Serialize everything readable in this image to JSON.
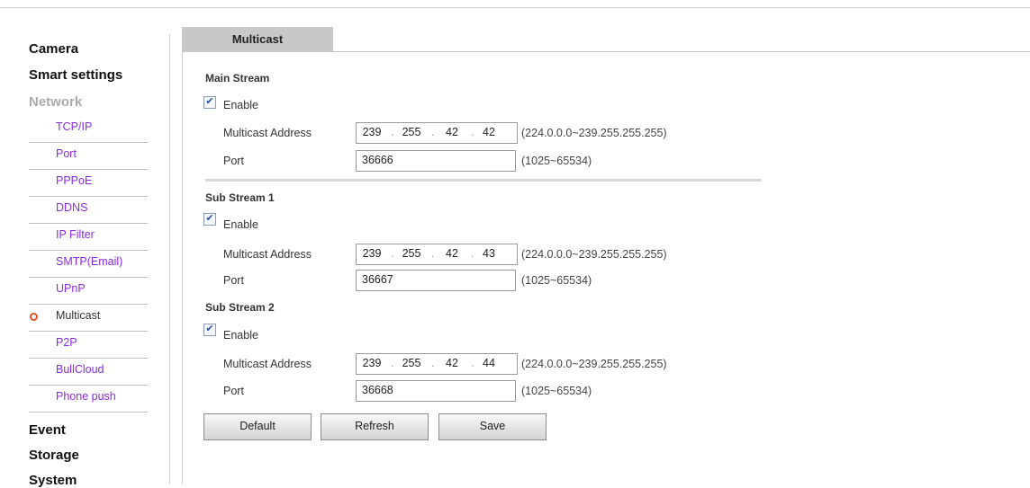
{
  "sidebar": {
    "categories": {
      "camera": "Camera",
      "smart": "Smart settings",
      "network": "Network",
      "event": "Event",
      "storage": "Storage",
      "system": "System"
    },
    "network_items": [
      "TCP/IP",
      "Port",
      "PPPoE",
      "DDNS",
      "IP Filter",
      "SMTP(Email)",
      "UPnP",
      "Multicast",
      "P2P",
      "BullCloud",
      "Phone push"
    ],
    "active_item": "Multicast"
  },
  "tab": {
    "label": "Multicast"
  },
  "streams": [
    {
      "title": "Main Stream",
      "enable_label": "Enable",
      "enabled": true,
      "address_label": "Multicast Address",
      "address": [
        "239",
        "255",
        "42",
        "42"
      ],
      "address_hint": "(224.0.0.0~239.255.255.255)",
      "port_label": "Port",
      "port": "36666",
      "port_hint": "(1025~65534)"
    },
    {
      "title": "Sub Stream 1",
      "enable_label": "Enable",
      "enabled": true,
      "address_label": "Multicast Address",
      "address": [
        "239",
        "255",
        "42",
        "43"
      ],
      "address_hint": "(224.0.0.0~239.255.255.255)",
      "port_label": "Port",
      "port": "36667",
      "port_hint": "(1025~65534)"
    },
    {
      "title": "Sub Stream 2",
      "enable_label": "Enable",
      "enabled": true,
      "address_label": "Multicast Address",
      "address": [
        "239",
        "255",
        "42",
        "44"
      ],
      "address_hint": "(224.0.0.0~239.255.255.255)",
      "port_label": "Port",
      "port": "36668",
      "port_hint": "(1025~65534)"
    }
  ],
  "buttons": {
    "default": "Default",
    "refresh": "Refresh",
    "save": "Save"
  },
  "colors": {
    "link": "#8a2be2",
    "active_bullet": "#e2532a",
    "tab_bg": "#c8c8c8"
  }
}
